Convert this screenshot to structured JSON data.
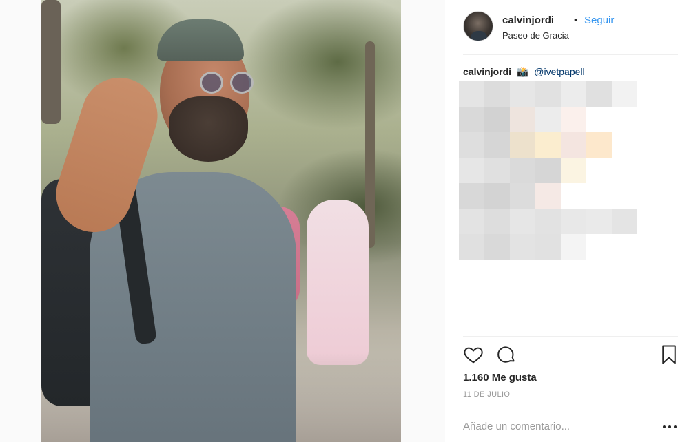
{
  "post": {
    "author": {
      "username": "calvinjordi",
      "separator": "•",
      "follow_label": "Seguir",
      "location": "Paseo de Gracia"
    },
    "caption": {
      "username": "calvinjordi",
      "emoji": "📸",
      "mention": "@ivetpapell"
    },
    "likes_text": "1.160 Me gusta",
    "date_text": "11 DE JULIO",
    "comment_placeholder": "Añade un comentario...",
    "icons": {
      "like": "heart-icon",
      "comment": "comment-icon",
      "save": "bookmark-icon",
      "more": "more-options-icon"
    },
    "colors": {
      "link_blue": "#3897f0",
      "text": "#262626",
      "muted": "#999999"
    }
  }
}
